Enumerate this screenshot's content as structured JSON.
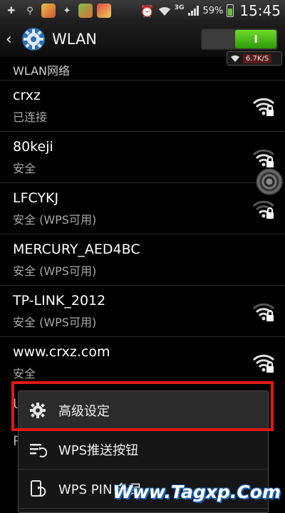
{
  "status_bar": {
    "icons": [
      "plus-icon",
      "usb-icon",
      "app-icon",
      "notification-icon",
      "app-icon",
      "app-icon"
    ],
    "network": "3G",
    "battery": "59%",
    "time": "15:45"
  },
  "header": {
    "title": "WLAN",
    "toggle_label": "I",
    "speed": "6.7K/S"
  },
  "section_label": "WLAN网络",
  "networks": [
    {
      "name": "crxz",
      "status": "已连接"
    },
    {
      "name": "80keji",
      "status": "安全"
    },
    {
      "name": "LFCYKJ",
      "status": "安全 (WPS可用)"
    },
    {
      "name": "MERCURY_AED4BC",
      "status": "安全 (WPS可用)"
    },
    {
      "name": "TP-LINK_2012",
      "status": "安全 (WPS可用)"
    },
    {
      "name": "www.crxz.com",
      "status": "安全"
    }
  ],
  "partial_rows": {
    "row7_initial": "U",
    "row8_initial": "P"
  },
  "menu": {
    "items": [
      {
        "label": "高级设定",
        "icon": "gear-icon"
      },
      {
        "label": "WPS推送按钮",
        "icon": "wps-push-icon"
      },
      {
        "label": "WPS PIN 条目",
        "icon": "wps-pin-icon"
      }
    ]
  },
  "watermark": "Www.Tagxp.Com",
  "colors": {
    "accent_green": "#4cc41a",
    "highlight_red": "#e01818"
  }
}
